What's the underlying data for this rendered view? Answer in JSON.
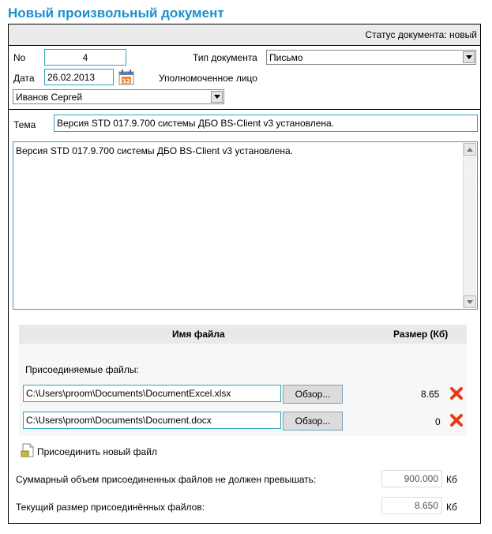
{
  "page_title": "Новый произвольный документ",
  "status": "Статус документа: новый",
  "fields": {
    "no_label": "No",
    "no_value": "4",
    "date_label": "Дата",
    "date_value": "26.02.2013",
    "doc_type_label": "Тип документа",
    "doc_type_value": "Письмо",
    "authorized_label": "Уполномоченное лицо",
    "authorized_value": "Иванов Сергей",
    "subject_label": "Тема",
    "subject_value": "Версия STD 017.9.700 системы ДБО BS-Client v3 установлена.",
    "body_text": "Версия STD 017.9.700 системы ДБО BS-Client v3 установлена."
  },
  "files": {
    "col_name": "Имя файла",
    "col_size": "Размер (Кб)",
    "attached_label": "Присоединяемые файлы:",
    "browse_label": "Обзор...",
    "rows": [
      {
        "path": "C:\\Users\\proom\\Documents\\DocumentExcel.xlsx",
        "size": "8.65"
      },
      {
        "path": "C:\\Users\\proom\\Documents\\Document.docx",
        "size": "0"
      }
    ],
    "attach_new_label": "Присоединить новый файл"
  },
  "limits": {
    "max_label": "Суммарный объем присоединенных файлов не должен превышать:",
    "max_value": "900.000",
    "max_unit": "Кб",
    "current_label": "Текущий размер присоединённых файлов:",
    "current_value": "8.650",
    "current_unit": "Кб"
  },
  "icons": {
    "calendar": "calendar-icon",
    "delete": "delete-icon",
    "attach": "attach-file-icon"
  },
  "colors": {
    "title": "#1a8fcf",
    "input_border": "#2fa4b6",
    "delete": "#e53d1a"
  }
}
